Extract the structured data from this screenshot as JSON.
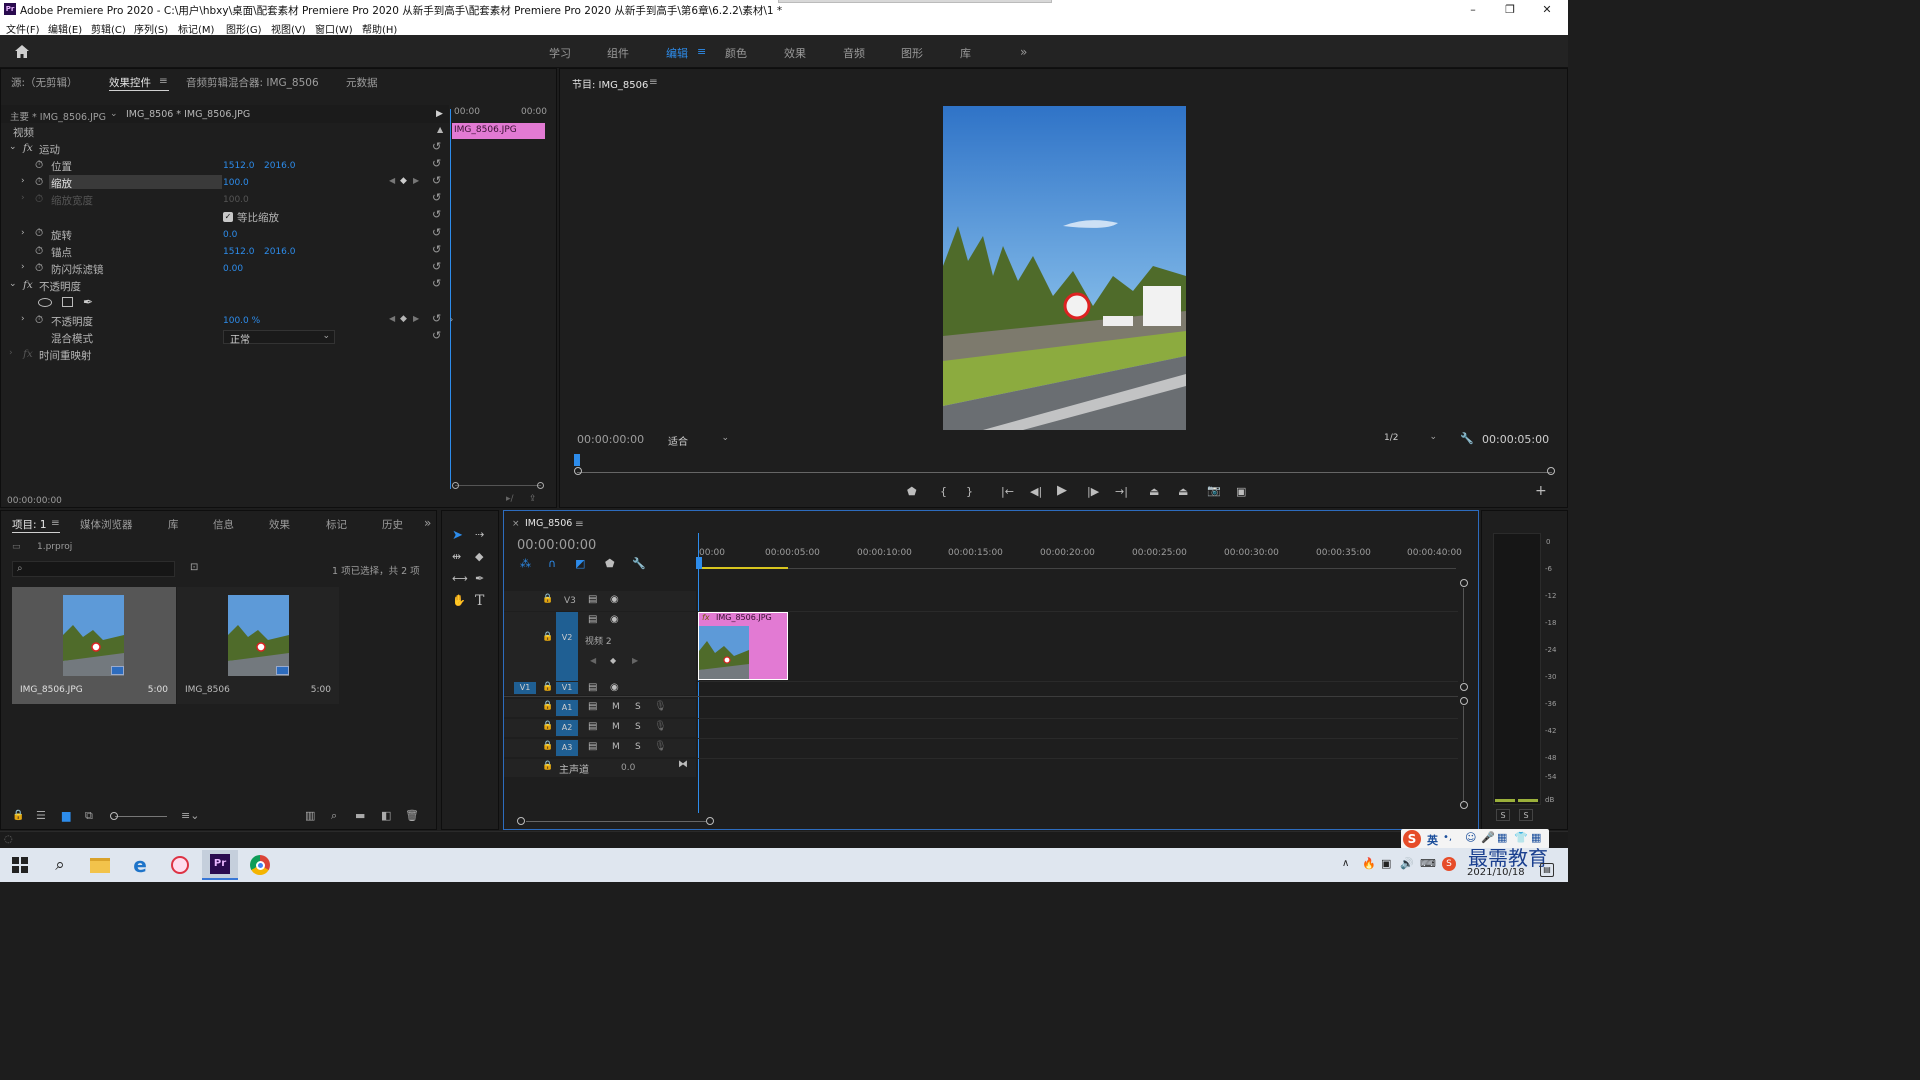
{
  "window": {
    "title": "Adobe Premiere Pro 2020 - C:\\用户\\hbxy\\桌面\\配套素材 Premiere Pro 2020 从新手到高手\\配套素材 Premiere Pro 2020 从新手到高手\\第6章\\6.2.2\\素材\\1 *",
    "app_icon": "Pr"
  },
  "menu": [
    "文件(F)",
    "编辑(E)",
    "剪辑(C)",
    "序列(S)",
    "标记(M)",
    "图形(G)",
    "视图(V)",
    "窗口(W)",
    "帮助(H)"
  ],
  "workspaces": [
    "学习",
    "组件",
    "编辑",
    "颜色",
    "效果",
    "音频",
    "图形",
    "库"
  ],
  "active_workspace": "编辑",
  "effect_controls": {
    "tabs": [
      "源:（无剪辑）",
      "效果控件",
      "音频剪辑混合器: IMG_8506",
      "元数据"
    ],
    "master_clip": "主要 * IMG_8506.JPG",
    "sequence_clip": "IMG_8506 * IMG_8506.JPG",
    "ruler_start": "00:00",
    "ruler_end": "00:00",
    "clip_bar": "IMG_8506.JPG",
    "section_video": "视频",
    "motion": "运动",
    "props": {
      "position": {
        "label": "位置",
        "x": "1512.0",
        "y": "2016.0"
      },
      "scale": {
        "label": "缩放",
        "value": "100.0"
      },
      "scale_width": {
        "label": "缩放宽度",
        "value": "100.0"
      },
      "uniform": {
        "label": "等比缩放",
        "checked": true
      },
      "rotation": {
        "label": "旋转",
        "value": "0.0"
      },
      "anchor": {
        "label": "锚点",
        "x": "1512.0",
        "y": "2016.0"
      },
      "antiflicker": {
        "label": "防闪烁滤镜",
        "value": "0.00"
      }
    },
    "opacity_section": "不透明度",
    "opacity": {
      "label": "不透明度",
      "value": "100.0 %"
    },
    "blend": {
      "label": "混合模式",
      "value": "正常"
    },
    "time_remap": "时间重映射",
    "timecode": "00:00:00:00"
  },
  "program": {
    "title": "节目: IMG_8506",
    "timecode": "00:00:00:00",
    "fit": "适合",
    "resolution": "1/2",
    "duration": "00:00:05:00"
  },
  "project": {
    "tabs": [
      "项目: 1",
      "媒体浏览器",
      "库",
      "信息",
      "效果",
      "标记",
      "历史"
    ],
    "file": "1.prproj",
    "selection_info": "1 项已选择，共 2 项",
    "items": [
      {
        "name": "IMG_8506.JPG",
        "duration": "5:00",
        "selected": true
      },
      {
        "name": "IMG_8506",
        "duration": "5:00",
        "selected": false
      }
    ]
  },
  "timeline": {
    "sequence": "IMG_8506",
    "timecode": "00:00:00:00",
    "ruler": [
      "00:00",
      "00:00:05:00",
      "00:00:10:00",
      "00:00:15:00",
      "00:00:20:00",
      "00:00:25:00",
      "00:00:30:00",
      "00:00:35:00",
      "00:00:40:00"
    ],
    "tracks_video": [
      "V3",
      "V2",
      "V1"
    ],
    "tracks_audio": [
      "A1",
      "A2",
      "A3"
    ],
    "v2_name": "视频 2",
    "source_patch": "V1",
    "master": {
      "label": "主声道",
      "value": "0.0"
    },
    "clip_label": "IMG_8506.JPG",
    "mute": "M",
    "solo": "S"
  },
  "audio_meter": {
    "scale": [
      "0",
      "-6",
      "-12",
      "-18",
      "-24",
      "-30",
      "-36",
      "-42",
      "-48",
      "-54",
      "dB"
    ],
    "solo": [
      "S",
      "S"
    ]
  },
  "taskbar": {
    "date": "2021/10/18",
    "ime": "英",
    "watermark": "最需教育"
  },
  "colors": {
    "accent": "#2d8ceb",
    "clip_pink": "#e27ad3",
    "panel_bg": "#1e1e1e",
    "track_label": "#1f5f93"
  }
}
